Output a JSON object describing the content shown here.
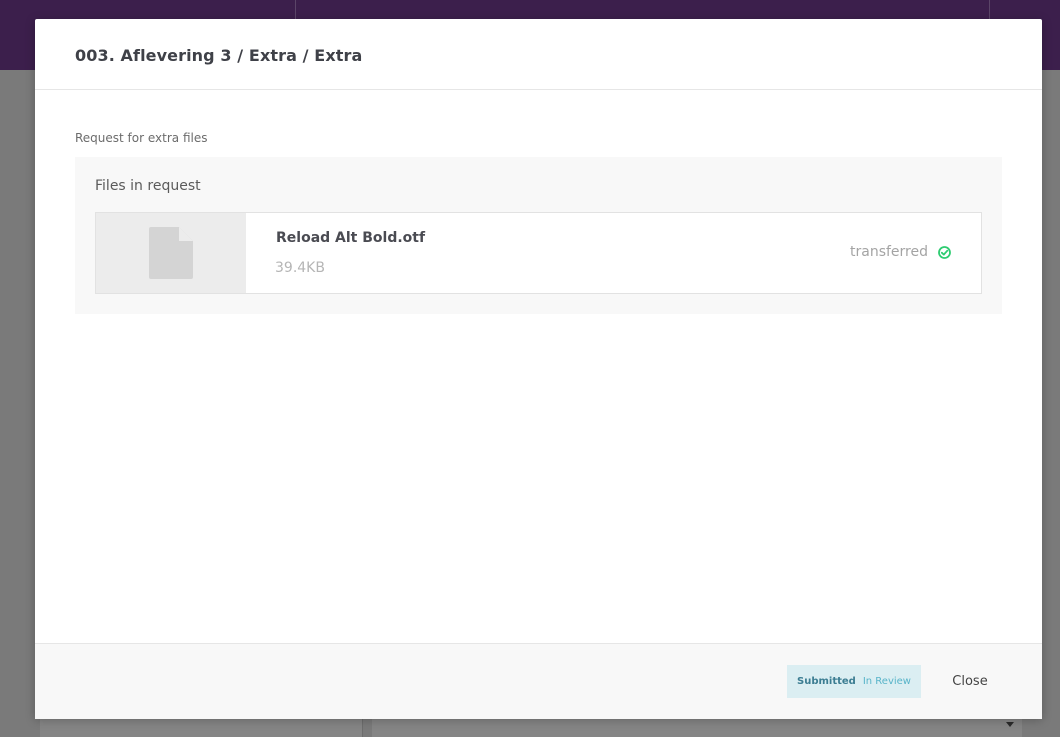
{
  "modal": {
    "title": "003. Aflevering 3 / Extra / Extra",
    "section_label": "Request for extra files",
    "files_heading": "Files in request",
    "files": [
      {
        "name": "Reload Alt Bold.otf",
        "size": "39.4KB",
        "status": "transferred",
        "status_icon": "check-circle-icon"
      }
    ],
    "footer": {
      "status_primary": "Submitted",
      "status_secondary": "In Review",
      "close_label": "Close"
    }
  },
  "colors": {
    "topbar": "#3c1f4c",
    "overlay": "#7a7a7a",
    "success": "#2ecc71",
    "pill_bg": "#dbeef2",
    "pill_primary": "#3c7d92",
    "pill_secondary": "#58b4c9"
  }
}
